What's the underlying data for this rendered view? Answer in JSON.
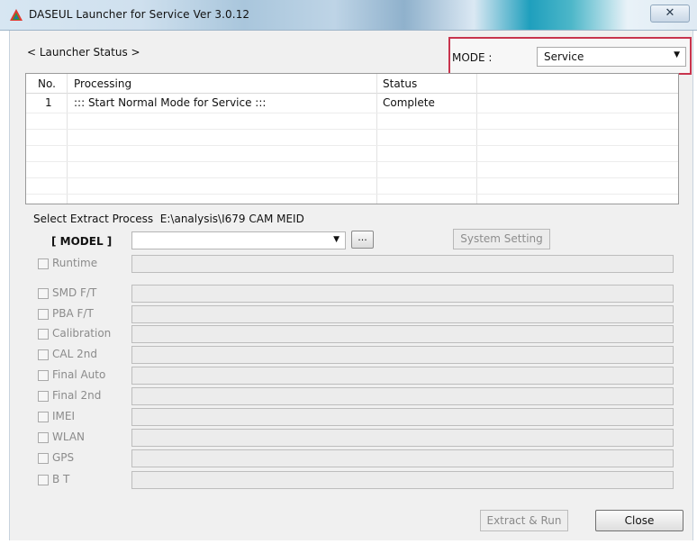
{
  "window": {
    "title": "DASEUL Launcher for Service Ver 3.0.12",
    "close_glyph": "✕"
  },
  "status": {
    "section_label": "< Launcher Status >",
    "mode_label": "MODE :",
    "mode_value": "Service",
    "columns": [
      "No.",
      "Processing",
      "Status"
    ],
    "rows": [
      {
        "no": "1",
        "processing": "::: Start Normal Mode for Service :::",
        "status": "Complete"
      }
    ]
  },
  "extract": {
    "label": "Select Extract Process",
    "path": "E:\\analysis\\I679 CAM MEID",
    "model_label": "[ MODEL ]",
    "model_value": "",
    "browse_label": "...",
    "system_setting_label": "System Setting",
    "processes": [
      "Runtime",
      "SMD F/T",
      "PBA F/T",
      "Calibration",
      "CAL 2nd",
      "Final Auto",
      "Final 2nd",
      "IMEI",
      "WLAN",
      "GPS",
      "B T"
    ]
  },
  "buttons": {
    "extract_run": "Extract & Run",
    "close": "Close"
  },
  "colors": {
    "highlight_border": "#c8344d"
  }
}
